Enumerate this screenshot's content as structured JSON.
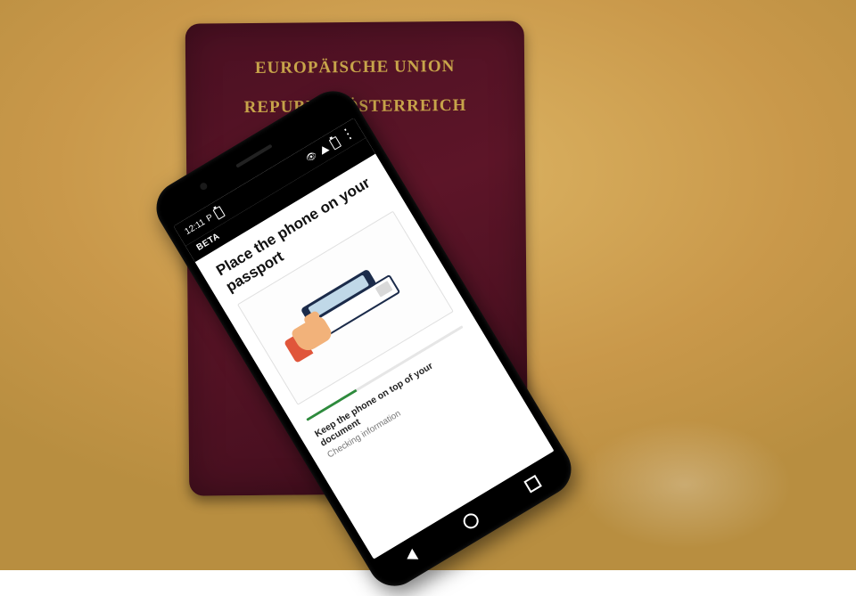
{
  "passport": {
    "line1": "EUROPÄISCHE UNION",
    "line2": "REPUBLIK ÖSTERREICH"
  },
  "phone": {
    "statusbar": {
      "time": "12:11",
      "indicator": "P"
    },
    "beta_label": "BETA",
    "screen": {
      "title": "Place the phone on your passport",
      "progress_percent": 32,
      "hint": "Keep the phone on top of your document",
      "status": "Checking information"
    }
  }
}
